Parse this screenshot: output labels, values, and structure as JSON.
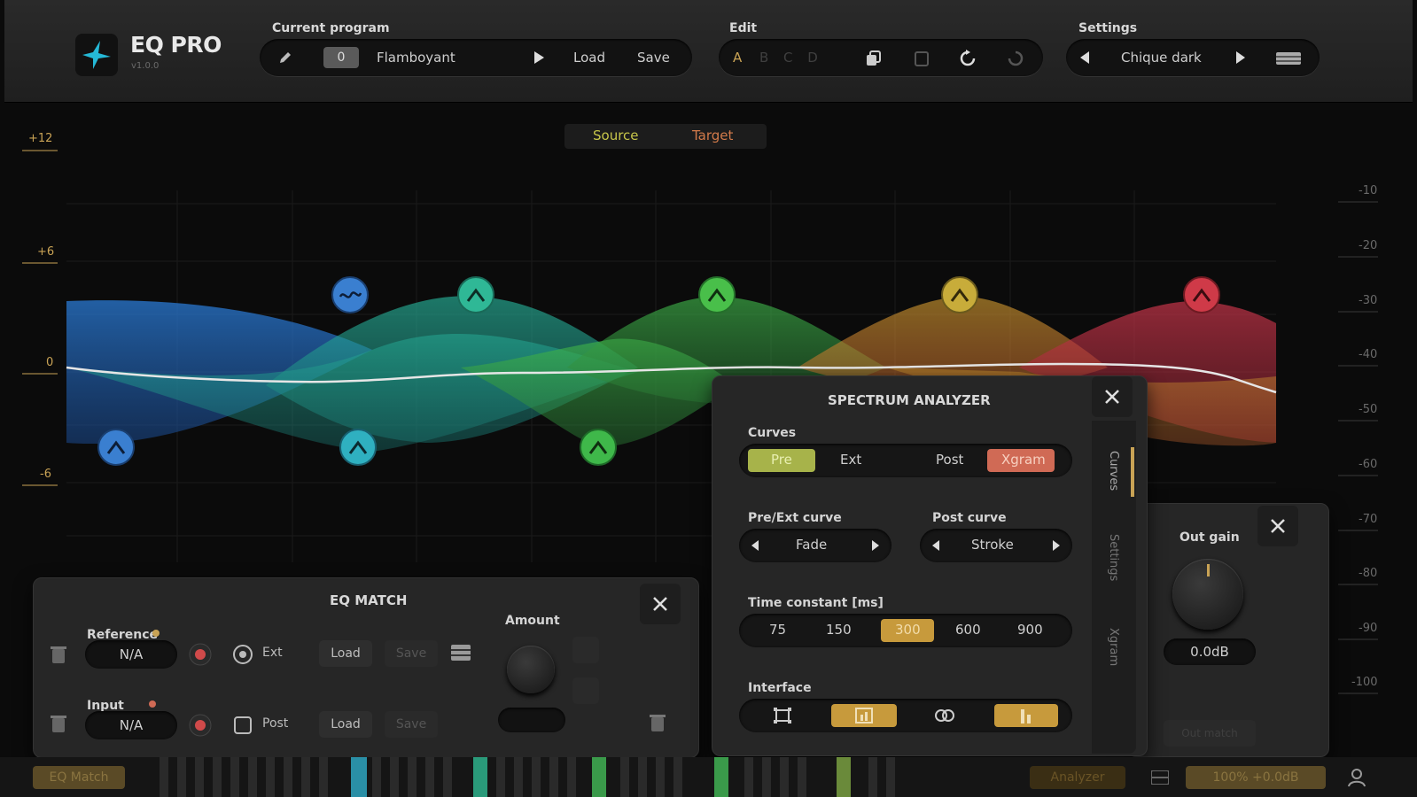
{
  "app": {
    "name": "EQ PRO",
    "version": "v1.0.0"
  },
  "program": {
    "label": "Current program",
    "number": "0",
    "name": "Flamboyant",
    "load": "Load",
    "save": "Save"
  },
  "edit": {
    "label": "Edit",
    "slot": "A",
    "slots_dim": "B  C  D"
  },
  "settings": {
    "label": "Settings",
    "theme": "Chique dark"
  },
  "view": {
    "source": "Source",
    "target": "Target"
  },
  "axis": {
    "left": [
      "+12",
      "+6",
      "0",
      "-6"
    ],
    "right": [
      "-10",
      "-20",
      "-30",
      "-40",
      "-50",
      "-60",
      "-70",
      "-80",
      "-90",
      "-100"
    ]
  },
  "spectrum": {
    "title": "SPECTRUM ANALYZER",
    "curves_label": "Curves",
    "curves": [
      "Pre",
      "Ext",
      "Post",
      "Xgram"
    ],
    "pre_ext_label": "Pre/Ext curve",
    "pre_ext_value": "Fade",
    "post_label": "Post curve",
    "post_value": "Stroke",
    "time_label": "Time constant [ms]",
    "times": [
      "75",
      "150",
      "300",
      "600",
      "900"
    ],
    "time_selected": "300",
    "interface_label": "Interface",
    "tabs": [
      "Curves",
      "Settings",
      "Xgram"
    ]
  },
  "eqmatch": {
    "title": "EQ MATCH",
    "reference_label": "Reference",
    "reference_value": "N/A",
    "ext": "Ext",
    "input_label": "Input",
    "input_value": "N/A",
    "post": "Post",
    "load": "Load",
    "save": "Save",
    "amount_label": "Amount"
  },
  "outgain": {
    "label": "Out gain",
    "value": "0.0dB",
    "dim_button": "Out match"
  },
  "bottom": {
    "left": "EQ Match",
    "analyzer": "Analyzer",
    "zoom": "100%  +0.0dB"
  },
  "colors": {
    "accent": "#c9a355",
    "pre": "#a7b34a",
    "xgram": "#d06a55",
    "selected": "#c79a3c"
  }
}
